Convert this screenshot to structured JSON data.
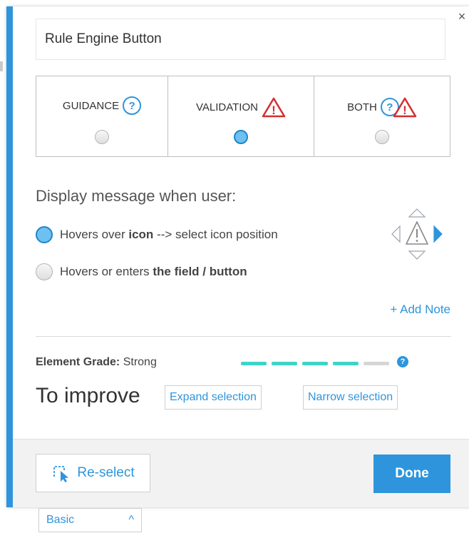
{
  "close_glyph": "×",
  "element_name": {
    "value": "Rule Engine Button",
    "placeholder": ""
  },
  "message_types": [
    {
      "label": "GUIDANCE",
      "icon": "question-icon",
      "selected": false
    },
    {
      "label": "VALIDATION",
      "icon": "warning-icon",
      "selected": true
    },
    {
      "label": "BOTH",
      "icon": "question-and-warning-icons",
      "selected": false
    }
  ],
  "help_glyph": "?",
  "warn_glyph": "!",
  "display": {
    "title": "Display message when user:",
    "options": [
      {
        "before": "Hovers over ",
        "bold": "icon",
        "after": " --> select icon position",
        "selected": true
      },
      {
        "before": "Hovers or enters ",
        "bold": "the field / button",
        "after": "",
        "selected": false
      }
    ]
  },
  "add_note": "+ Add Note",
  "grade": {
    "label": "Element Grade:",
    "value": " Strong",
    "level": 4,
    "max": 5,
    "help_glyph": "?"
  },
  "improve": {
    "label": "To improve",
    "expand": "Expand selection",
    "narrow": "Narrow selection"
  },
  "footer": {
    "reselect": "Re-select",
    "done": "Done"
  },
  "mode_select": {
    "value": "Basic",
    "chevron": "^"
  },
  "colors": {
    "accent": "#2e95dd",
    "warning": "#d32f2f",
    "grade_fill": "#3fd4c7",
    "grade_empty": "#d6d6d6"
  }
}
